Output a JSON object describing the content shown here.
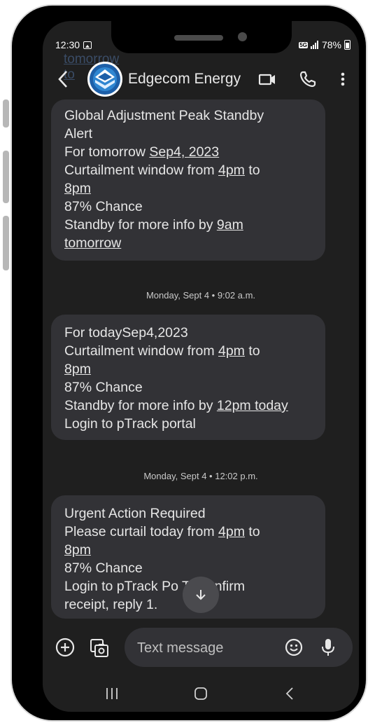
{
  "status_bar": {
    "time": "12:30",
    "network": "5G",
    "battery": "78%"
  },
  "ghost_lines": [
    "tomorrow",
    "to"
  ],
  "header": {
    "contact_name": "Edgecom Energy"
  },
  "messages": [
    {
      "lines": [
        [
          {
            "t": "Global Adjustment Peak Standby"
          }
        ],
        [
          {
            "t": "Alert"
          }
        ],
        [
          {
            "t": "For tomorrow "
          },
          {
            "t": "Sep4, 2023",
            "u": true
          }
        ],
        [
          {
            "t": "Curtailment window from "
          },
          {
            "t": "4pm",
            "u": true
          },
          {
            "t": " to"
          }
        ],
        [
          {
            "t": "8pm",
            "u": true
          }
        ],
        [
          {
            "t": "87% Chance"
          }
        ],
        [
          {
            "t": "Standby for more info by "
          },
          {
            "t": "9am",
            "u": true
          }
        ],
        [
          {
            "t": "tomorrow",
            "u": true
          }
        ]
      ]
    },
    {
      "timestamp": "Monday, Sept 4 • 9:02 a.m.",
      "lines": [
        [
          {
            "t": "For todaySep4,2023"
          }
        ],
        [
          {
            "t": "Curtailment window from "
          },
          {
            "t": "4pm",
            "u": true
          },
          {
            "t": " to"
          }
        ],
        [
          {
            "t": "8pm",
            "u": true
          }
        ],
        [
          {
            "t": "87% Chance"
          }
        ],
        [
          {
            "t": "Standby for more info by "
          },
          {
            "t": "12pm today",
            "u": true
          }
        ],
        [
          {
            "t": "Login to pTrack portal"
          }
        ]
      ]
    },
    {
      "timestamp": "Monday, Sept 4 • 12:02 p.m.",
      "lines": [
        [
          {
            "t": "Urgent Action Required"
          }
        ],
        [
          {
            "t": "Please curtail today from "
          },
          {
            "t": "4pm",
            "u": true
          },
          {
            "t": " to"
          }
        ],
        [
          {
            "t": "8pm",
            "u": true
          }
        ],
        [
          {
            "t": "87% Chance"
          }
        ],
        [
          {
            "t": "Login to pTrack Po"
          },
          {
            "t": "           "
          },
          {
            "t": "To confirm"
          }
        ],
        [
          {
            "t": "receipt, reply 1."
          }
        ]
      ]
    }
  ],
  "compose": {
    "placeholder": "Text message"
  },
  "colors": {
    "screen_bg": "#1f1f1f",
    "bubble_bg": "#323236",
    "text": "#e6e6e6",
    "avatar_blue": "#1d6fb8"
  },
  "icons": [
    "back-arrow-icon",
    "video-call-icon",
    "phone-icon",
    "more-vert-icon",
    "scroll-down-arrow-icon",
    "add-circle-icon",
    "gallery-icon",
    "emoji-icon",
    "mic-icon",
    "recents-icon",
    "home-icon",
    "nav-back-icon"
  ]
}
